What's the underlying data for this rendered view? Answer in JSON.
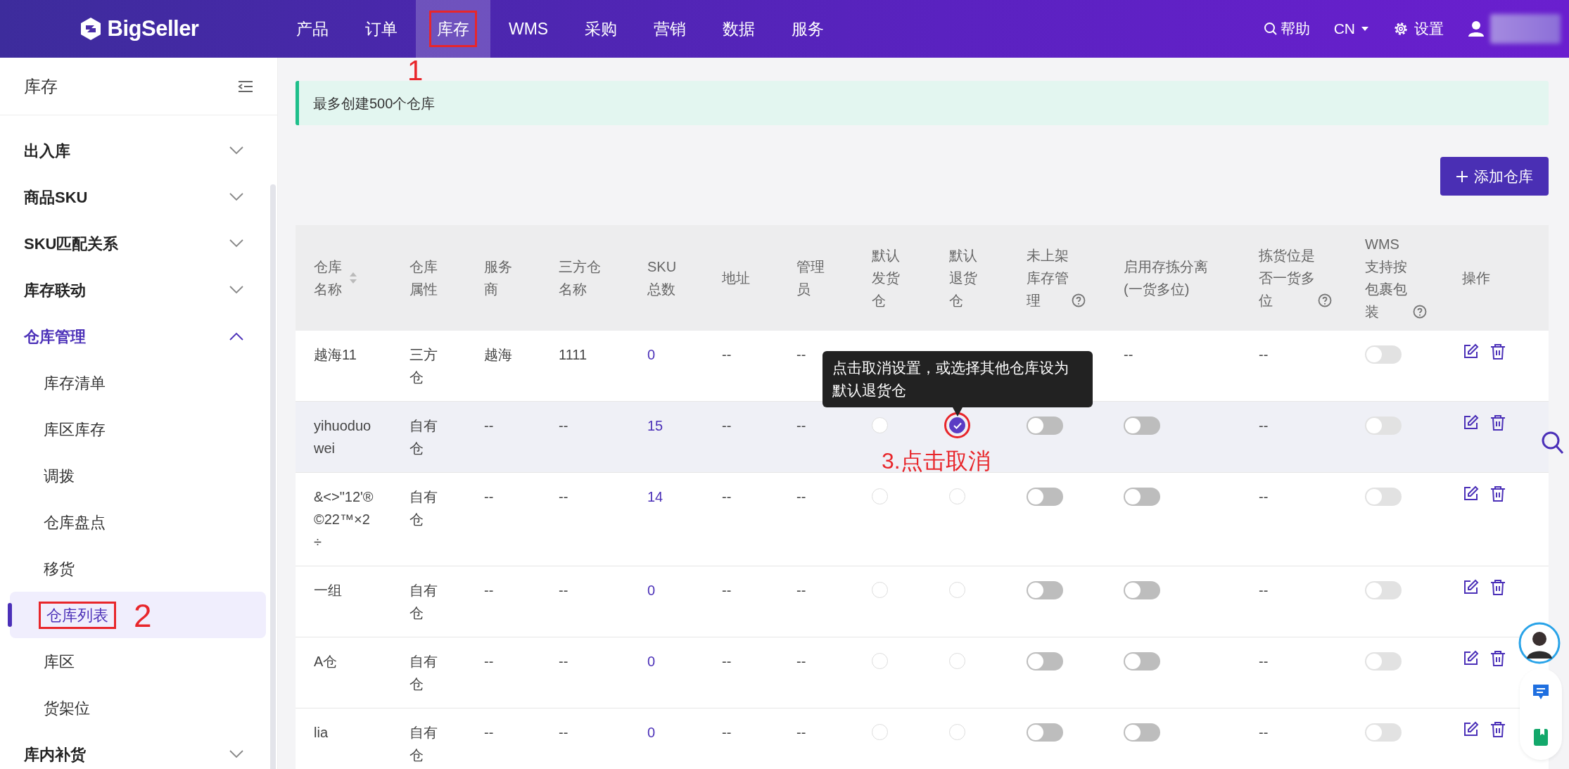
{
  "brand": {
    "name": "BigSeller"
  },
  "nav": [
    {
      "label": "产品",
      "selected": false
    },
    {
      "label": "订单",
      "selected": false
    },
    {
      "label": "库存",
      "selected": true,
      "callout": "1"
    },
    {
      "label": "WMS",
      "selected": false
    },
    {
      "label": "采购",
      "selected": false
    },
    {
      "label": "营销",
      "selected": false
    },
    {
      "label": "数据",
      "selected": false
    },
    {
      "label": "服务",
      "selected": false
    }
  ],
  "topbar_right": {
    "help": "帮助",
    "language": "CN",
    "settings": "设置"
  },
  "sidebar": {
    "title": "库存",
    "items": [
      {
        "label": "出入库",
        "expanded": false
      },
      {
        "label": "商品SKU",
        "expanded": false
      },
      {
        "label": "SKU匹配关系",
        "expanded": false
      },
      {
        "label": "库存联动",
        "expanded": false
      },
      {
        "label": "仓库管理",
        "expanded": true,
        "children": [
          {
            "label": "库存清单",
            "selected": false
          },
          {
            "label": "库区库存",
            "selected": false
          },
          {
            "label": "调拨",
            "selected": false
          },
          {
            "label": "仓库盘点",
            "selected": false
          },
          {
            "label": "移货",
            "selected": false
          },
          {
            "label": "仓库列表",
            "selected": true,
            "callout": "2"
          },
          {
            "label": "库区",
            "selected": false
          },
          {
            "label": "货架位",
            "selected": false
          }
        ]
      },
      {
        "label": "库内补货",
        "expanded": false
      }
    ]
  },
  "notice": "最多创建500个仓库",
  "add_button": "添加仓库",
  "table": {
    "columns": [
      {
        "label": "仓库名称",
        "sortable": true
      },
      {
        "label": "仓库属性"
      },
      {
        "label": "服务商"
      },
      {
        "label": "三方仓名称"
      },
      {
        "label": "SKU总数"
      },
      {
        "label": "地址"
      },
      {
        "label": "管理员"
      },
      {
        "label": "默认发货仓"
      },
      {
        "label": "默认退货仓"
      },
      {
        "label": "未上架库存管理",
        "help": true
      },
      {
        "label": "启用存拣分离(一货多位)"
      },
      {
        "label": "拣货位是否一货多位",
        "help": true
      },
      {
        "label": "WMS支持按包裹包装",
        "help": true
      },
      {
        "label": "操作"
      }
    ],
    "rows": [
      {
        "highlighted": false,
        "cells": [
          {
            "kind": "text",
            "text": "越海11"
          },
          {
            "kind": "text",
            "text": "三方仓"
          },
          {
            "kind": "text",
            "text": "越海"
          },
          {
            "kind": "text",
            "text": "1111"
          },
          {
            "kind": "link",
            "text": "0"
          },
          {
            "kind": "text",
            "text": "--"
          },
          {
            "kind": "text",
            "text": "--"
          },
          {
            "kind": "hidden"
          },
          {
            "kind": "hidden"
          },
          {
            "kind": "hidden"
          },
          {
            "kind": "text",
            "text": "--"
          },
          {
            "kind": "text",
            "text": "--"
          },
          {
            "kind": "toggle",
            "on": false,
            "disabled": true
          },
          {
            "kind": "actions"
          }
        ]
      },
      {
        "highlighted": true,
        "cells": [
          {
            "kind": "text",
            "text": "yihuoduowei"
          },
          {
            "kind": "text",
            "text": "自有仓"
          },
          {
            "kind": "text",
            "text": "--"
          },
          {
            "kind": "text",
            "text": "--"
          },
          {
            "kind": "link",
            "text": "15"
          },
          {
            "kind": "text",
            "text": "--"
          },
          {
            "kind": "text",
            "text": "--"
          },
          {
            "kind": "radio",
            "checked": false
          },
          {
            "kind": "radio",
            "checked": true,
            "callout": "3.点击取消",
            "tooltip": "点击取消设置，或选择其他仓库设为默认退货仓"
          },
          {
            "kind": "toggle",
            "on": false,
            "disabled": false
          },
          {
            "kind": "toggle",
            "on": false,
            "disabled": false
          },
          {
            "kind": "text",
            "text": "--"
          },
          {
            "kind": "toggle",
            "on": false,
            "disabled": true
          },
          {
            "kind": "actions"
          }
        ]
      },
      {
        "highlighted": false,
        "cells": [
          {
            "kind": "text",
            "text": "&<>\"12'®©22™×2÷"
          },
          {
            "kind": "text",
            "text": "自有仓"
          },
          {
            "kind": "text",
            "text": "--"
          },
          {
            "kind": "text",
            "text": "--"
          },
          {
            "kind": "link",
            "text": "14"
          },
          {
            "kind": "text",
            "text": "--"
          },
          {
            "kind": "text",
            "text": "--"
          },
          {
            "kind": "radio",
            "checked": false
          },
          {
            "kind": "radio",
            "checked": false
          },
          {
            "kind": "toggle",
            "on": false,
            "disabled": false
          },
          {
            "kind": "toggle",
            "on": false,
            "disabled": false
          },
          {
            "kind": "text",
            "text": "--"
          },
          {
            "kind": "toggle",
            "on": false,
            "disabled": true
          },
          {
            "kind": "actions"
          }
        ]
      },
      {
        "highlighted": false,
        "cells": [
          {
            "kind": "text",
            "text": "一组"
          },
          {
            "kind": "text",
            "text": "自有仓"
          },
          {
            "kind": "text",
            "text": "--"
          },
          {
            "kind": "text",
            "text": "--"
          },
          {
            "kind": "link",
            "text": "0"
          },
          {
            "kind": "text",
            "text": "--"
          },
          {
            "kind": "text",
            "text": "--"
          },
          {
            "kind": "radio",
            "checked": false
          },
          {
            "kind": "radio",
            "checked": false
          },
          {
            "kind": "toggle",
            "on": false,
            "disabled": false
          },
          {
            "kind": "toggle",
            "on": false,
            "disabled": false
          },
          {
            "kind": "text",
            "text": "--"
          },
          {
            "kind": "toggle",
            "on": false,
            "disabled": true
          },
          {
            "kind": "actions"
          }
        ]
      },
      {
        "highlighted": false,
        "cells": [
          {
            "kind": "text",
            "text": "A仓"
          },
          {
            "kind": "text",
            "text": "自有仓"
          },
          {
            "kind": "text",
            "text": "--"
          },
          {
            "kind": "text",
            "text": "--"
          },
          {
            "kind": "link",
            "text": "0"
          },
          {
            "kind": "text",
            "text": "--"
          },
          {
            "kind": "text",
            "text": "--"
          },
          {
            "kind": "radio",
            "checked": false
          },
          {
            "kind": "radio",
            "checked": false
          },
          {
            "kind": "toggle",
            "on": false,
            "disabled": false
          },
          {
            "kind": "toggle",
            "on": false,
            "disabled": false
          },
          {
            "kind": "text",
            "text": "--"
          },
          {
            "kind": "toggle",
            "on": false,
            "disabled": true
          },
          {
            "kind": "actions"
          }
        ]
      },
      {
        "highlighted": false,
        "cells": [
          {
            "kind": "text",
            "text": "lia"
          },
          {
            "kind": "text",
            "text": "自有仓"
          },
          {
            "kind": "text",
            "text": "--"
          },
          {
            "kind": "text",
            "text": "--"
          },
          {
            "kind": "link",
            "text": "0"
          },
          {
            "kind": "text",
            "text": "--"
          },
          {
            "kind": "text",
            "text": "--"
          },
          {
            "kind": "radio",
            "checked": false
          },
          {
            "kind": "radio",
            "checked": false
          },
          {
            "kind": "toggle",
            "on": false,
            "disabled": false
          },
          {
            "kind": "toggle",
            "on": false,
            "disabled": false
          },
          {
            "kind": "text",
            "text": "--"
          },
          {
            "kind": "toggle",
            "on": false,
            "disabled": true
          },
          {
            "kind": "actions"
          }
        ]
      }
    ]
  }
}
